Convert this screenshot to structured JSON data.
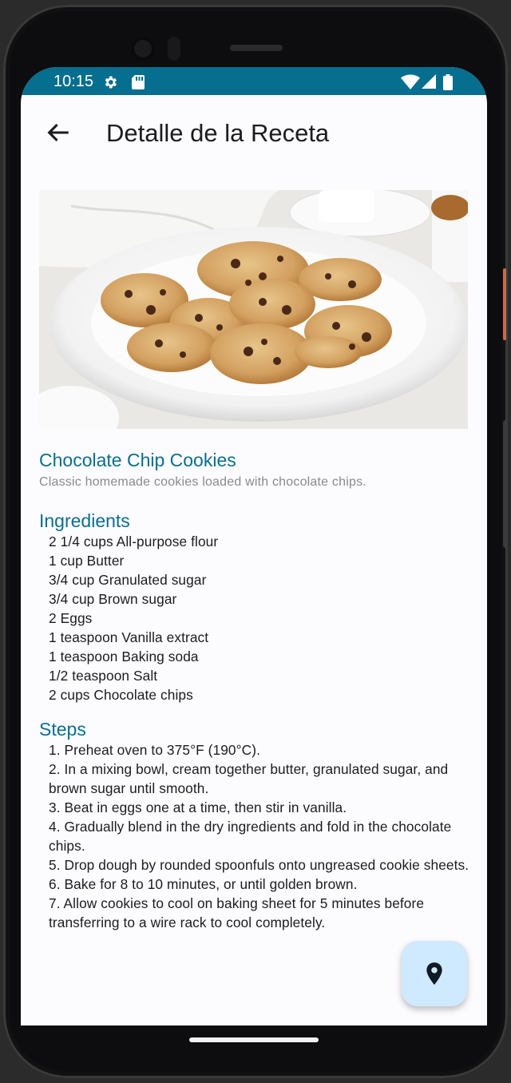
{
  "status_bar": {
    "time": "10:15",
    "icons": [
      "settings-icon",
      "sd-card-icon",
      "wifi-icon",
      "signal-icon",
      "battery-icon"
    ],
    "background": "#066e8f"
  },
  "app_bar": {
    "title": "Detalle de la Receta",
    "back_icon": "arrow-back-icon"
  },
  "recipe": {
    "image": "chocolate-chip-cookies-on-plate",
    "name": "Chocolate Chip Cookies",
    "description": "Classic homemade cookies loaded with chocolate chips."
  },
  "ingredients": {
    "title": "Ingredients",
    "items": [
      "2 1/4 cups  All-purpose flour",
      "1 cup  Butter",
      "3/4 cup  Granulated sugar",
      "3/4 cup  Brown sugar",
      "2  Eggs",
      "1 teaspoon  Vanilla extract",
      "1 teaspoon  Baking soda",
      "1/2 teaspoon  Salt",
      "2 cups  Chocolate chips"
    ]
  },
  "steps": {
    "title": "Steps",
    "items": [
      "1. Preheat oven to 375°F (190°C).",
      "2. In a mixing bowl, cream together butter, granulated sugar, and brown sugar until smooth.",
      "3. Beat in eggs one at a time, then stir in vanilla.",
      "4. Gradually blend in the dry ingredients and fold in the chocolate chips.",
      "5. Drop dough by rounded spoonfuls onto ungreased cookie sheets.",
      "6. Bake for 8 to 10 minutes, or until golden brown.",
      "7. Allow cookies to cool on baking sheet for 5 minutes before transferring to a wire rack to cool completely."
    ]
  },
  "fab": {
    "icon": "location-pin-icon",
    "color": "#cfe9ff"
  },
  "colors": {
    "accent": "#0b6e8e",
    "screen_background": "#fcfbfe"
  }
}
